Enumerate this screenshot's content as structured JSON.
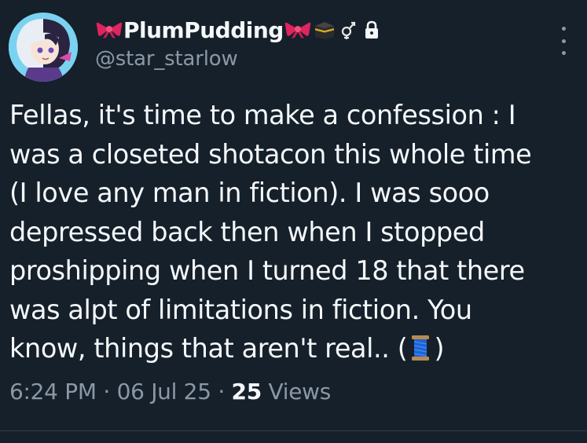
{
  "tweet": {
    "display_name": "PlumPudding",
    "handle": "@star_starlow",
    "body_lines": [
      "Fellas, it's time to make a confession : I",
      "was a closeted shotacon this whole time",
      "(I love any man in fiction). I was sooo",
      "depressed back then when I stopped",
      "proshipping when I turned 18 that there",
      "was alpt of limitations in fiction. You",
      "know, things that aren't real.. ("
    ],
    "body_last_suffix": ")",
    "time": "6:24 PM",
    "date": "06 Jul 25",
    "separator": "·",
    "views_count": "25",
    "views_label": "Views"
  },
  "icons": {
    "bow_left": "ribbon-icon",
    "bow_right": "ribbon-icon",
    "kaaba": "kaaba-icon",
    "trans_symbol": "transgender-symbol-icon",
    "lock": "lock-icon",
    "thread": "spool-of-thread-icon",
    "more": "more-options-icon"
  },
  "colors": {
    "background": "#15202b",
    "text_primary": "#f5f8fa",
    "text_secondary": "#8b98a5",
    "bow": "#e0245e"
  }
}
